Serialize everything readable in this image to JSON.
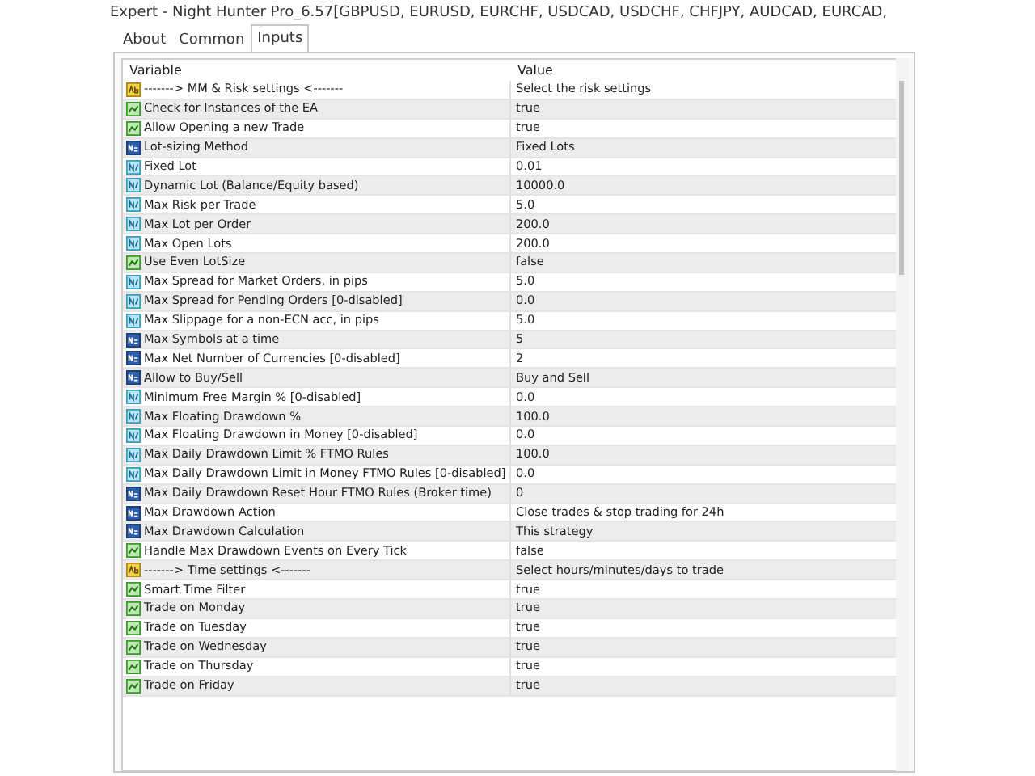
{
  "window": {
    "title": "Expert - Night Hunter Pro_6.57[GBPUSD, EURUSD, EURCHF, USDCAD, USDCHF, CHFJPY, AUDCAD, EURCAD,"
  },
  "tabs": [
    {
      "label": "About",
      "selected": false
    },
    {
      "label": "Common",
      "selected": false
    },
    {
      "label": "Inputs",
      "selected": true
    }
  ],
  "table": {
    "columns": [
      "Variable",
      "Value"
    ],
    "rows": [
      {
        "kind": "string",
        "variable": "-------> MM & Risk settings <-------",
        "value": "Select the risk settings"
      },
      {
        "kind": "bool",
        "variable": "Check for Instances of the EA",
        "value": "true"
      },
      {
        "kind": "bool",
        "variable": "Allow Opening a new Trade",
        "value": "true"
      },
      {
        "kind": "int",
        "variable": "Lot-sizing Method",
        "value": "Fixed Lots"
      },
      {
        "kind": "double",
        "variable": "Fixed Lot",
        "value": "0.01"
      },
      {
        "kind": "double",
        "variable": "Dynamic Lot (Balance/Equity based)",
        "value": "10000.0"
      },
      {
        "kind": "double",
        "variable": "Max Risk per Trade",
        "value": "5.0"
      },
      {
        "kind": "double",
        "variable": "Max Lot per Order",
        "value": "200.0"
      },
      {
        "kind": "double",
        "variable": "Max Open Lots",
        "value": "200.0"
      },
      {
        "kind": "bool",
        "variable": "Use Even LotSize",
        "value": "false"
      },
      {
        "kind": "double",
        "variable": "Max Spread for Market Orders, in pips",
        "value": "5.0"
      },
      {
        "kind": "double",
        "variable": "Max Spread for Pending Orders [0-disabled]",
        "value": "0.0"
      },
      {
        "kind": "double",
        "variable": "Max Slippage for a non-ECN acc, in pips",
        "value": "5.0"
      },
      {
        "kind": "int",
        "variable": "Max Symbols at a time",
        "value": "5"
      },
      {
        "kind": "int",
        "variable": "Max Net Number of Currencies [0-disabled]",
        "value": "2"
      },
      {
        "kind": "int",
        "variable": "Allow to Buy/Sell",
        "value": "Buy and Sell"
      },
      {
        "kind": "double",
        "variable": "Minimum Free Margin % [0-disabled]",
        "value": "0.0"
      },
      {
        "kind": "double",
        "variable": "Max Floating Drawdown %",
        "value": "100.0"
      },
      {
        "kind": "double",
        "variable": "Max Floating Drawdown in Money [0-disabled]",
        "value": "0.0"
      },
      {
        "kind": "double",
        "variable": "Max Daily Drawdown Limit % FTMO Rules",
        "value": "100.0"
      },
      {
        "kind": "double",
        "variable": "Max Daily Drawdown Limit in Money FTMO Rules [0-disabled]",
        "value": "0.0"
      },
      {
        "kind": "int",
        "variable": "Max Daily Drawdown Reset Hour FTMO Rules (Broker time)",
        "value": "0"
      },
      {
        "kind": "int",
        "variable": "Max Drawdown Action",
        "value": "Close trades & stop trading for 24h"
      },
      {
        "kind": "int",
        "variable": "Max Drawdown Calculation",
        "value": "This strategy"
      },
      {
        "kind": "bool",
        "variable": "Handle Max Drawdown Events on Every Tick",
        "value": "false"
      },
      {
        "kind": "string",
        "variable": "-------> Time settings <-------",
        "value": "Select hours/minutes/days to trade"
      },
      {
        "kind": "bool",
        "variable": "Smart Time Filter",
        "value": "true"
      },
      {
        "kind": "bool",
        "variable": "Trade on Monday",
        "value": "true"
      },
      {
        "kind": "bool",
        "variable": "Trade on Tuesday",
        "value": "true"
      },
      {
        "kind": "bool",
        "variable": "Trade on Wednesday",
        "value": "true"
      },
      {
        "kind": "bool",
        "variable": "Trade on Thursday",
        "value": "true"
      },
      {
        "kind": "bool",
        "variable": "Trade on Friday",
        "value": "true"
      }
    ]
  }
}
